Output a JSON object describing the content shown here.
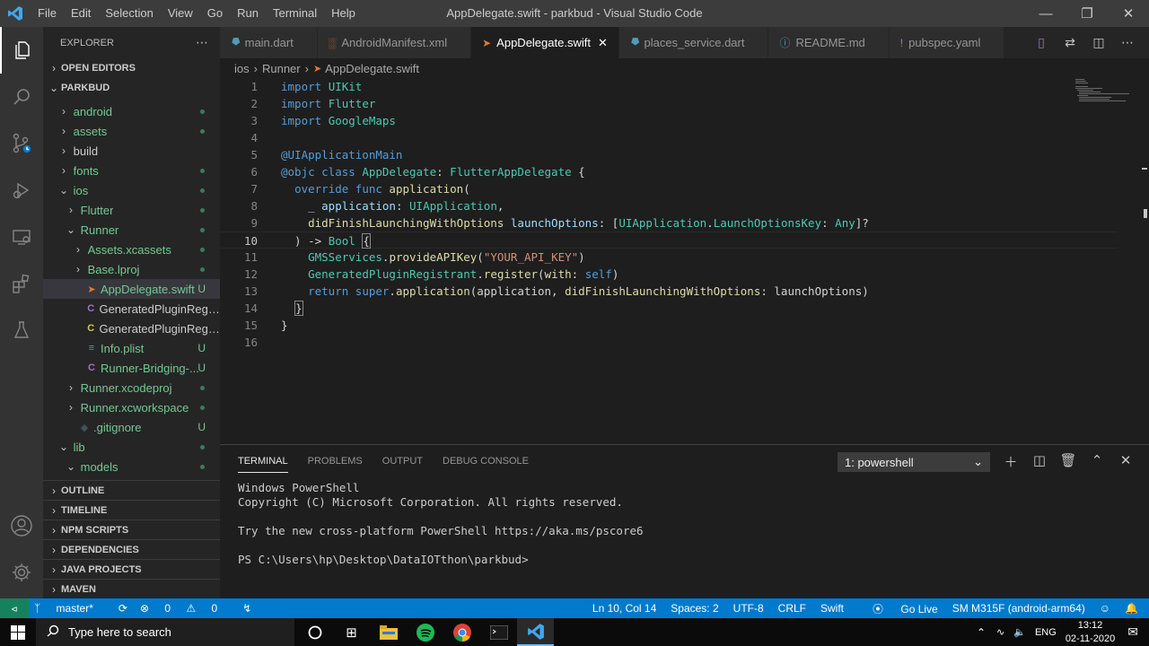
{
  "app": {
    "title": "AppDelegate.swift - parkbud - Visual Studio Code",
    "menu": [
      "File",
      "Edit",
      "Selection",
      "View",
      "Go",
      "Run",
      "Terminal",
      "Help"
    ]
  },
  "sidebar": {
    "header": "EXPLORER",
    "open_editors": "OPEN EDITORS",
    "project": "PARKBUD",
    "tree": [
      {
        "label": "android",
        "kind": "folder",
        "status": "dot"
      },
      {
        "label": "assets",
        "kind": "folder",
        "status": "dot"
      },
      {
        "label": "build",
        "kind": "folder",
        "status": ""
      },
      {
        "label": "fonts",
        "kind": "folder",
        "status": "dot"
      },
      {
        "label": "ios",
        "kind": "folder-open",
        "status": "dot"
      },
      {
        "label": "Flutter",
        "kind": "folder",
        "status": "dot"
      },
      {
        "label": "Runner",
        "kind": "folder-open",
        "status": "dot"
      },
      {
        "label": "Assets.xcassets",
        "kind": "folder",
        "status": "dot"
      },
      {
        "label": "Base.lproj",
        "kind": "folder",
        "status": "dot"
      },
      {
        "label": "AppDelegate.swift",
        "kind": "swift",
        "status": "U"
      },
      {
        "label": "GeneratedPluginRegistr...",
        "kind": "c-purple",
        "status": ""
      },
      {
        "label": "GeneratedPluginRegistr...",
        "kind": "c-yellow",
        "status": ""
      },
      {
        "label": "Info.plist",
        "kind": "plist",
        "status": "U"
      },
      {
        "label": "Runner-Bridging-...",
        "kind": "c-purple",
        "status": "U"
      },
      {
        "label": "Runner.xcodeproj",
        "kind": "folder",
        "status": "dot"
      },
      {
        "label": "Runner.xcworkspace",
        "kind": "folder",
        "status": "dot"
      },
      {
        "label": ".gitignore",
        "kind": "git",
        "status": "U"
      },
      {
        "label": "lib",
        "kind": "folder-open",
        "status": "dot"
      },
      {
        "label": "models",
        "kind": "folder-open",
        "status": "dot"
      }
    ],
    "sections": [
      "OUTLINE",
      "TIMELINE",
      "NPM SCRIPTS",
      "DEPENDENCIES",
      "JAVA PROJECTS",
      "MAVEN"
    ]
  },
  "tabs": [
    {
      "label": "main.dart",
      "icon": "dart",
      "icon_color": "#519aba"
    },
    {
      "label": "AndroidManifest.xml",
      "icon": "xml",
      "icon_color": "#e37933"
    },
    {
      "label": "AppDelegate.swift",
      "icon": "swift",
      "icon_color": "#e37933",
      "active": true
    },
    {
      "label": "places_service.dart",
      "icon": "dart",
      "icon_color": "#519aba"
    },
    {
      "label": "README.md",
      "icon": "info",
      "icon_color": "#519aba"
    },
    {
      "label": "pubspec.yaml",
      "icon": "yaml",
      "icon_color": "#a074c4"
    }
  ],
  "breadcrumb": [
    "ios",
    "Runner",
    "AppDelegate.swift"
  ],
  "editor": {
    "current_line": 10,
    "lines": [
      [
        [
          "kw",
          "import "
        ],
        [
          "ty",
          "UIKit"
        ]
      ],
      [
        [
          "kw",
          "import "
        ],
        [
          "ty",
          "Flutter"
        ]
      ],
      [
        [
          "kw",
          "import "
        ],
        [
          "ty",
          "GoogleMaps"
        ]
      ],
      [],
      [
        [
          "at",
          "@UIApplicationMain"
        ]
      ],
      [
        [
          "at",
          "@objc "
        ],
        [
          "kw",
          "class "
        ],
        [
          "ty",
          "AppDelegate"
        ],
        [
          "pl",
          ": "
        ],
        [
          "ty",
          "FlutterAppDelegate"
        ],
        [
          "pl",
          " {"
        ]
      ],
      [
        [
          "pl",
          "  "
        ],
        [
          "kw",
          "override func "
        ],
        [
          "fn",
          "application"
        ],
        [
          "pl",
          "("
        ]
      ],
      [
        [
          "pl",
          "    _ "
        ],
        [
          "var",
          "application"
        ],
        [
          "pl",
          ": "
        ],
        [
          "ty",
          "UIApplication"
        ],
        [
          "pl",
          ","
        ]
      ],
      [
        [
          "pl",
          "    "
        ],
        [
          "fn",
          "didFinishLaunchingWithOptions "
        ],
        [
          "var",
          "launchOptions"
        ],
        [
          "pl",
          ": ["
        ],
        [
          "ty",
          "UIApplication"
        ],
        [
          "pl",
          "."
        ],
        [
          "ty",
          "LaunchOptionsKey"
        ],
        [
          "pl",
          ": "
        ],
        [
          "ty",
          "Any"
        ],
        [
          "pl",
          "]?"
        ]
      ],
      [
        [
          "pl",
          "  ) -> "
        ],
        [
          "ty",
          "Bool"
        ],
        [
          "pl",
          " "
        ],
        [
          "bm",
          "{"
        ]
      ],
      [
        [
          "pl",
          "    "
        ],
        [
          "ty",
          "GMSServices"
        ],
        [
          "pl",
          "."
        ],
        [
          "fn",
          "provideAPIKey"
        ],
        [
          "pl",
          "("
        ],
        [
          "str",
          "\"YOUR_API_KEY\""
        ],
        [
          "pl",
          ")"
        ]
      ],
      [
        [
          "pl",
          "    "
        ],
        [
          "ty",
          "GeneratedPluginRegistrant"
        ],
        [
          "pl",
          "."
        ],
        [
          "fn",
          "register"
        ],
        [
          "pl",
          "("
        ],
        [
          "fn",
          "with"
        ],
        [
          "pl",
          ": "
        ],
        [
          "kw",
          "self"
        ],
        [
          "pl",
          ")"
        ]
      ],
      [
        [
          "pl",
          "    "
        ],
        [
          "kw",
          "return super"
        ],
        [
          "pl",
          "."
        ],
        [
          "fn",
          "application"
        ],
        [
          "pl",
          "(application, "
        ],
        [
          "fn",
          "didFinishLaunchingWithOptions"
        ],
        [
          "pl",
          ": launchOptions)"
        ]
      ],
      [
        [
          "pl",
          "  "
        ],
        [
          "bm",
          "}"
        ]
      ],
      [
        [
          "pl",
          "}"
        ]
      ],
      []
    ]
  },
  "panel": {
    "tabs": [
      "TERMINAL",
      "PROBLEMS",
      "OUTPUT",
      "DEBUG CONSOLE"
    ],
    "shell": "1: powershell",
    "terminal_lines": [
      "Windows PowerShell",
      "Copyright (C) Microsoft Corporation. All rights reserved.",
      "",
      "Try the new cross-platform PowerShell https://aka.ms/pscore6",
      "",
      "PS C:\\Users\\hp\\Desktop\\DataIOTthon\\parkbud>"
    ]
  },
  "status": {
    "branch": "master*",
    "errors": "0",
    "warnings": "0",
    "position": "Ln 10, Col 14",
    "spaces": "Spaces: 2",
    "encoding": "UTF-8",
    "eol": "CRLF",
    "language": "Swift",
    "golive": "Go Live",
    "device": "SM M315F (android-arm64)"
  },
  "taskbar": {
    "search": "Type here to search",
    "lang": "ENG",
    "time": "13:12",
    "date": "02-11-2020"
  }
}
